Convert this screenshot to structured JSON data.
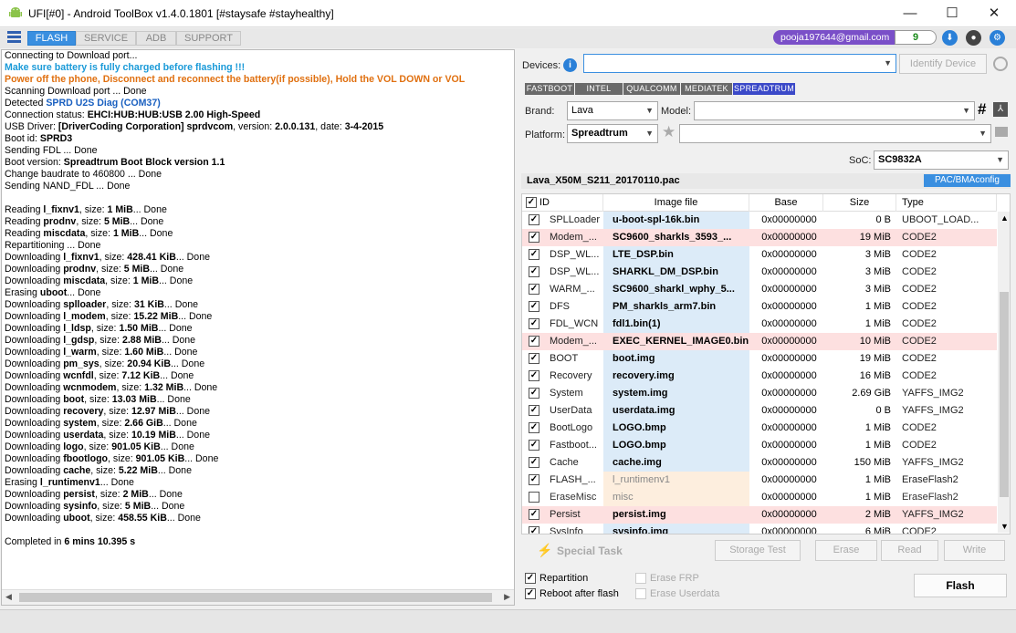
{
  "window": {
    "title": "UFI[#0] - Android ToolBox v1.4.0.1801 [#staysafe #stayhealthy]",
    "min": "—",
    "max": "☐",
    "close": "✕"
  },
  "tabs": [
    {
      "label": "FLASH"
    },
    {
      "label": "SERVICE"
    },
    {
      "label": "ADB"
    },
    {
      "label": "SUPPORT"
    }
  ],
  "account": {
    "email": "pooja197644@gmail.com",
    "credits": "9"
  },
  "log": [
    {
      "parts": [
        {
          "t": "Connecting to Download port..."
        }
      ]
    },
    {
      "color": "#1a9ad8",
      "parts": [
        {
          "t": "Make sure battery is fully charged before flashing !!!",
          "b": true
        }
      ]
    },
    {
      "color": "#e07010",
      "parts": [
        {
          "t": "Power off the phone, Disconnect and reconnect the battery(if possible), Hold the VOL DOWN or VOL",
          "b": true
        }
      ]
    },
    {
      "parts": [
        {
          "t": "Scanning Download port ... Done"
        }
      ]
    },
    {
      "parts": [
        {
          "t": "Detected "
        },
        {
          "t": "SPRD U2S Diag (COM37)",
          "b": true,
          "c": "#1a60c0"
        }
      ]
    },
    {
      "parts": [
        {
          "t": "Connection status: "
        },
        {
          "t": "EHCI:HUB:HUB:USB 2.00 High-Speed",
          "b": true
        }
      ]
    },
    {
      "parts": [
        {
          "t": "USB Driver: "
        },
        {
          "t": "[DriverCoding Corporation] sprdvcom",
          "b": true
        },
        {
          "t": ", version: "
        },
        {
          "t": "2.0.0.131",
          "b": true
        },
        {
          "t": ", date: "
        },
        {
          "t": "3-4-2015",
          "b": true
        }
      ]
    },
    {
      "parts": [
        {
          "t": "Boot id: "
        },
        {
          "t": "SPRD3",
          "b": true
        }
      ]
    },
    {
      "parts": [
        {
          "t": "Sending FDL ... Done"
        }
      ]
    },
    {
      "parts": [
        {
          "t": "Boot version: "
        },
        {
          "t": "Spreadtrum Boot Block version 1.1",
          "b": true
        }
      ]
    },
    {
      "parts": [
        {
          "t": "Change baudrate to 460800 ... Done"
        }
      ]
    },
    {
      "parts": [
        {
          "t": "Sending NAND_FDL ... Done"
        }
      ]
    },
    {
      "parts": [
        {
          "t": ""
        }
      ]
    },
    {
      "parts": [
        {
          "t": "Reading "
        },
        {
          "t": "l_fixnv1",
          "b": true
        },
        {
          "t": ", size: "
        },
        {
          "t": "1 MiB",
          "b": true
        },
        {
          "t": "... Done"
        }
      ]
    },
    {
      "parts": [
        {
          "t": "Reading "
        },
        {
          "t": "prodnv",
          "b": true
        },
        {
          "t": ", size: "
        },
        {
          "t": "5 MiB",
          "b": true
        },
        {
          "t": "... Done"
        }
      ]
    },
    {
      "parts": [
        {
          "t": "Reading "
        },
        {
          "t": "miscdata",
          "b": true
        },
        {
          "t": ", size: "
        },
        {
          "t": "1 MiB",
          "b": true
        },
        {
          "t": "... Done"
        }
      ]
    },
    {
      "parts": [
        {
          "t": "Repartitioning ... Done"
        }
      ]
    },
    {
      "parts": [
        {
          "t": "Downloading "
        },
        {
          "t": "l_fixnv1",
          "b": true
        },
        {
          "t": ", size: "
        },
        {
          "t": "428.41 KiB",
          "b": true
        },
        {
          "t": "... Done"
        }
      ]
    },
    {
      "parts": [
        {
          "t": "Downloading "
        },
        {
          "t": "prodnv",
          "b": true
        },
        {
          "t": ", size: "
        },
        {
          "t": "5 MiB",
          "b": true
        },
        {
          "t": "... Done"
        }
      ]
    },
    {
      "parts": [
        {
          "t": "Downloading "
        },
        {
          "t": "miscdata",
          "b": true
        },
        {
          "t": ", size: "
        },
        {
          "t": "1 MiB",
          "b": true
        },
        {
          "t": "... Done"
        }
      ]
    },
    {
      "parts": [
        {
          "t": "Erasing "
        },
        {
          "t": "uboot",
          "b": true
        },
        {
          "t": "... Done"
        }
      ]
    },
    {
      "parts": [
        {
          "t": "Downloading "
        },
        {
          "t": "splloader",
          "b": true
        },
        {
          "t": ", size: "
        },
        {
          "t": "31 KiB",
          "b": true
        },
        {
          "t": "... Done"
        }
      ]
    },
    {
      "parts": [
        {
          "t": "Downloading "
        },
        {
          "t": "l_modem",
          "b": true
        },
        {
          "t": ", size: "
        },
        {
          "t": "15.22 MiB",
          "b": true
        },
        {
          "t": "... Done"
        }
      ]
    },
    {
      "parts": [
        {
          "t": "Downloading "
        },
        {
          "t": "l_ldsp",
          "b": true
        },
        {
          "t": ", size: "
        },
        {
          "t": "1.50 MiB",
          "b": true
        },
        {
          "t": "... Done"
        }
      ]
    },
    {
      "parts": [
        {
          "t": "Downloading "
        },
        {
          "t": "l_gdsp",
          "b": true
        },
        {
          "t": ", size: "
        },
        {
          "t": "2.88 MiB",
          "b": true
        },
        {
          "t": "... Done"
        }
      ]
    },
    {
      "parts": [
        {
          "t": "Downloading "
        },
        {
          "t": "l_warm",
          "b": true
        },
        {
          "t": ", size: "
        },
        {
          "t": "1.60 MiB",
          "b": true
        },
        {
          "t": "... Done"
        }
      ]
    },
    {
      "parts": [
        {
          "t": "Downloading "
        },
        {
          "t": "pm_sys",
          "b": true
        },
        {
          "t": ", size: "
        },
        {
          "t": "20.94 KiB",
          "b": true
        },
        {
          "t": "... Done"
        }
      ]
    },
    {
      "parts": [
        {
          "t": "Downloading "
        },
        {
          "t": "wcnfdl",
          "b": true
        },
        {
          "t": ", size: "
        },
        {
          "t": "7.12 KiB",
          "b": true
        },
        {
          "t": "... Done"
        }
      ]
    },
    {
      "parts": [
        {
          "t": "Downloading "
        },
        {
          "t": "wcnmodem",
          "b": true
        },
        {
          "t": ", size: "
        },
        {
          "t": "1.32 MiB",
          "b": true
        },
        {
          "t": "... Done"
        }
      ]
    },
    {
      "parts": [
        {
          "t": "Downloading "
        },
        {
          "t": "boot",
          "b": true
        },
        {
          "t": ", size: "
        },
        {
          "t": "13.03 MiB",
          "b": true
        },
        {
          "t": "... Done"
        }
      ]
    },
    {
      "parts": [
        {
          "t": "Downloading "
        },
        {
          "t": "recovery",
          "b": true
        },
        {
          "t": ", size: "
        },
        {
          "t": "12.97 MiB",
          "b": true
        },
        {
          "t": "... Done"
        }
      ]
    },
    {
      "parts": [
        {
          "t": "Downloading "
        },
        {
          "t": "system",
          "b": true
        },
        {
          "t": ", size: "
        },
        {
          "t": "2.66 GiB",
          "b": true
        },
        {
          "t": "... Done"
        }
      ]
    },
    {
      "parts": [
        {
          "t": "Downloading "
        },
        {
          "t": "userdata",
          "b": true
        },
        {
          "t": ", size: "
        },
        {
          "t": "10.19 MiB",
          "b": true
        },
        {
          "t": "... Done"
        }
      ]
    },
    {
      "parts": [
        {
          "t": "Downloading "
        },
        {
          "t": "logo",
          "b": true
        },
        {
          "t": ", size: "
        },
        {
          "t": "901.05 KiB",
          "b": true
        },
        {
          "t": "... Done"
        }
      ]
    },
    {
      "parts": [
        {
          "t": "Downloading "
        },
        {
          "t": "fbootlogo",
          "b": true
        },
        {
          "t": ", size: "
        },
        {
          "t": "901.05 KiB",
          "b": true
        },
        {
          "t": "... Done"
        }
      ]
    },
    {
      "parts": [
        {
          "t": "Downloading "
        },
        {
          "t": "cache",
          "b": true
        },
        {
          "t": ", size: "
        },
        {
          "t": "5.22 MiB",
          "b": true
        },
        {
          "t": "... Done"
        }
      ]
    },
    {
      "parts": [
        {
          "t": "Erasing "
        },
        {
          "t": "l_runtimenv1",
          "b": true
        },
        {
          "t": "... Done"
        }
      ]
    },
    {
      "parts": [
        {
          "t": "Downloading "
        },
        {
          "t": "persist",
          "b": true
        },
        {
          "t": ", size: "
        },
        {
          "t": "2 MiB",
          "b": true
        },
        {
          "t": "... Done"
        }
      ]
    },
    {
      "parts": [
        {
          "t": "Downloading "
        },
        {
          "t": "sysinfo",
          "b": true
        },
        {
          "t": ", size: "
        },
        {
          "t": "5 MiB",
          "b": true
        },
        {
          "t": "... Done"
        }
      ]
    },
    {
      "parts": [
        {
          "t": "Downloading "
        },
        {
          "t": "uboot",
          "b": true
        },
        {
          "t": ", size: "
        },
        {
          "t": "458.55 KiB",
          "b": true
        },
        {
          "t": "... Done"
        }
      ]
    },
    {
      "parts": [
        {
          "t": ""
        }
      ]
    },
    {
      "parts": [
        {
          "t": "Completed in "
        },
        {
          "t": "6 mins 10.395 s",
          "b": true
        }
      ]
    }
  ],
  "devices": {
    "label": "Devices:",
    "value": "",
    "identify_label": "Identify Device"
  },
  "platform_tabs": [
    {
      "label": "FASTBOOT"
    },
    {
      "label": "INTEL"
    },
    {
      "label": "QUALCOMM"
    },
    {
      "label": "MEDIATEK"
    },
    {
      "label": "SPREADTRUM"
    }
  ],
  "brand": {
    "label": "Brand:",
    "value": "Lava"
  },
  "model": {
    "label": "Model:",
    "value": ""
  },
  "platform": {
    "label": "Platform:",
    "value": "Spreadtrum"
  },
  "soc": {
    "label": "SoC:",
    "value": "SC9832A"
  },
  "pac": {
    "file": "Lava_X50M_S211_20170110.pac",
    "config_label": "PAC/BMAconfig"
  },
  "grid": {
    "headers": {
      "id": "ID",
      "image": "Image file",
      "base": "Base",
      "size": "Size",
      "type": "Type"
    },
    "rows": [
      {
        "checked": true,
        "id": "SPLLoader",
        "image": "u-boot-spl-16k.bin",
        "base": "0x00000000",
        "size": "0 B",
        "type": "UBOOT_LOAD...",
        "hl": "normal"
      },
      {
        "checked": true,
        "id": "Modem_...",
        "image": "SC9600_sharkls_3593_...",
        "base": "0x00000000",
        "size": "19 MiB",
        "type": "CODE2",
        "hl": "pink"
      },
      {
        "checked": true,
        "id": "DSP_WL...",
        "image": "LTE_DSP.bin",
        "base": "0x00000000",
        "size": "3 MiB",
        "type": "CODE2",
        "hl": "normal"
      },
      {
        "checked": true,
        "id": "DSP_WL...",
        "image": "SHARKL_DM_DSP.bin",
        "base": "0x00000000",
        "size": "3 MiB",
        "type": "CODE2",
        "hl": "normal"
      },
      {
        "checked": true,
        "id": "WARM_...",
        "image": "SC9600_sharkl_wphy_5...",
        "base": "0x00000000",
        "size": "3 MiB",
        "type": "CODE2",
        "hl": "normal"
      },
      {
        "checked": true,
        "id": "DFS",
        "image": "PM_sharkls_arm7.bin",
        "base": "0x00000000",
        "size": "1 MiB",
        "type": "CODE2",
        "hl": "normal"
      },
      {
        "checked": true,
        "id": "FDL_WCN",
        "image": "fdl1.bin(1)",
        "base": "0x00000000",
        "size": "1 MiB",
        "type": "CODE2",
        "hl": "normal"
      },
      {
        "checked": true,
        "id": "Modem_...",
        "image": "EXEC_KERNEL_IMAGE0.bin",
        "base": "0x00000000",
        "size": "10 MiB",
        "type": "CODE2",
        "hl": "pink"
      },
      {
        "checked": true,
        "id": "BOOT",
        "image": "boot.img",
        "base": "0x00000000",
        "size": "19 MiB",
        "type": "CODE2",
        "hl": "normal"
      },
      {
        "checked": true,
        "id": "Recovery",
        "image": "recovery.img",
        "base": "0x00000000",
        "size": "16 MiB",
        "type": "CODE2",
        "hl": "normal"
      },
      {
        "checked": true,
        "id": "System",
        "image": "system.img",
        "base": "0x00000000",
        "size": "2.69 GiB",
        "type": "YAFFS_IMG2",
        "hl": "normal"
      },
      {
        "checked": true,
        "id": "UserData",
        "image": "userdata.img",
        "base": "0x00000000",
        "size": "0 B",
        "type": "YAFFS_IMG2",
        "hl": "normal"
      },
      {
        "checked": true,
        "id": "BootLogo",
        "image": "LOGO.bmp",
        "base": "0x00000000",
        "size": "1 MiB",
        "type": "CODE2",
        "hl": "normal"
      },
      {
        "checked": true,
        "id": "Fastboot...",
        "image": "LOGO.bmp",
        "base": "0x00000000",
        "size": "1 MiB",
        "type": "CODE2",
        "hl": "normal"
      },
      {
        "checked": true,
        "id": "Cache",
        "image": "cache.img",
        "base": "0x00000000",
        "size": "150 MiB",
        "type": "YAFFS_IMG2",
        "hl": "normal"
      },
      {
        "checked": true,
        "id": "FLASH_...",
        "image": "l_runtimenv1",
        "base": "0x00000000",
        "size": "1 MiB",
        "type": "EraseFlash2",
        "hl": "erase"
      },
      {
        "checked": false,
        "id": "EraseMisc",
        "image": "misc",
        "base": "0x00000000",
        "size": "1 MiB",
        "type": "EraseFlash2",
        "hl": "erase-dim"
      },
      {
        "checked": true,
        "id": "Persist",
        "image": "persist.img",
        "base": "0x00000000",
        "size": "2 MiB",
        "type": "YAFFS_IMG2",
        "hl": "pink"
      },
      {
        "checked": true,
        "id": "SysInfo",
        "image": "sysinfo.img",
        "base": "0x00000000",
        "size": "6 MiB",
        "type": "CODE2",
        "hl": "normal"
      }
    ]
  },
  "actions": {
    "special_task": "Special Task",
    "storage_test": "Storage Test",
    "erase": "Erase",
    "read": "Read",
    "write": "Write",
    "flash": "Flash"
  },
  "options": {
    "repartition": "Repartition",
    "reboot": "Reboot after flash",
    "erase_frp": "Erase FRP",
    "erase_userdata": "Erase Userdata"
  },
  "colors": {
    "accent": "#3a8fe0",
    "pink": "#fde0e0",
    "blue_cell": "#dcebf8",
    "erase_cell": "#fdeede",
    "email": "#7a4fc8",
    "spreadtrum_tab": "#3b49c8"
  }
}
